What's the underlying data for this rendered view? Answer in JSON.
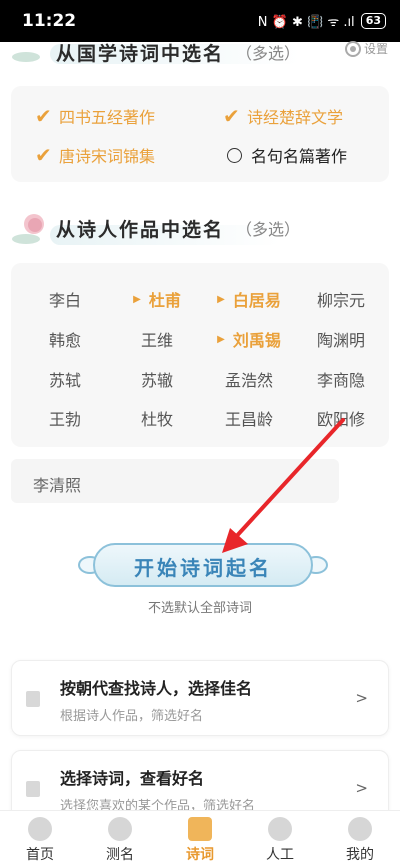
{
  "status": {
    "time": "11:22",
    "icons": "N ⏰ ✱ 📳 ᯤ .ıl",
    "battery": "63"
  },
  "section1": {
    "title": "从国学诗词中选名",
    "sub": "（多选）",
    "settings_label": "设置"
  },
  "categories": [
    {
      "label": "四书五经著作",
      "checked": true
    },
    {
      "label": "诗经楚辞文学",
      "checked": true
    },
    {
      "label": "唐诗宋词锦集",
      "checked": true
    },
    {
      "label": "名句名篇著作",
      "checked": false
    }
  ],
  "section2": {
    "title": "从诗人作品中选名",
    "sub": "（多选）"
  },
  "poets": [
    {
      "name": "李白",
      "selected": false
    },
    {
      "name": "杜甫",
      "selected": true
    },
    {
      "name": "白居易",
      "selected": true
    },
    {
      "name": "柳宗元",
      "selected": false
    },
    {
      "name": "韩愈",
      "selected": false
    },
    {
      "name": "王维",
      "selected": false
    },
    {
      "name": "刘禹锡",
      "selected": true
    },
    {
      "name": "陶渊明",
      "selected": false
    },
    {
      "name": "苏轼",
      "selected": false
    },
    {
      "name": "苏辙",
      "selected": false
    },
    {
      "name": "孟浩然",
      "selected": false
    },
    {
      "name": "李商隐",
      "selected": false
    },
    {
      "name": "王勃",
      "selected": false
    },
    {
      "name": "杜牧",
      "selected": false
    },
    {
      "name": "王昌龄",
      "selected": false
    },
    {
      "name": "欧阳修",
      "selected": false
    }
  ],
  "extra_poet": "李清照",
  "start": {
    "label": "开始诗词起名",
    "hint": "不选默认全部诗词"
  },
  "list": [
    {
      "title": "按朝代查找诗人，选择佳名",
      "sub": "根据诗人作品，筛选好名",
      "arrow": ">"
    },
    {
      "title": "选择诗词，查看好名",
      "sub": "选择您喜欢的某个作品，筛选好名",
      "arrow": ">"
    }
  ],
  "tabs": [
    {
      "label": "首页",
      "icon": "home-icon",
      "active": false
    },
    {
      "label": "测名",
      "icon": "test-name-icon",
      "active": false
    },
    {
      "label": "诗词",
      "icon": "poetry-icon",
      "active": true
    },
    {
      "label": "人工",
      "icon": "graduation-cap-icon",
      "active": false
    },
    {
      "label": "我的",
      "icon": "profile-icon",
      "active": false
    }
  ],
  "colors": {
    "accent": "#eaa13b",
    "button_blue": "#3a85b8",
    "arrow_red": "#e8262a"
  }
}
